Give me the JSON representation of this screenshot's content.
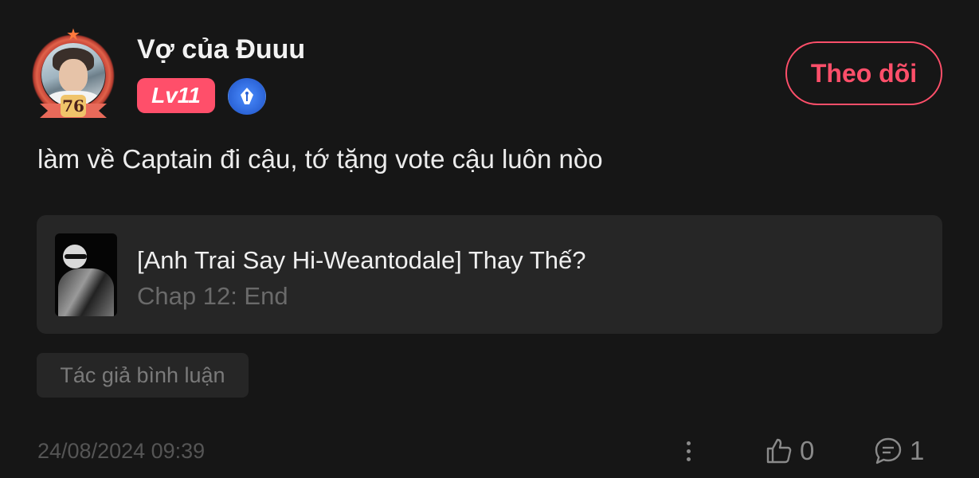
{
  "comment": {
    "author": {
      "name": "Vợ của Đuuu",
      "level": "Lv11",
      "avatar_frame_number": "76",
      "badges": [
        "level-badge",
        "writer-pen-badge"
      ]
    },
    "follow_label": "Theo dõi",
    "text": "làm về Captain đi cậu, tớ tặng vote cậu luôn nòo",
    "linked_story": {
      "title": "[Anh Trai Say Hi-Weantodale] Thay Thế?",
      "chapter": "Chap 12: End"
    },
    "author_tag": "Tác giả bình luận",
    "timestamp": "24/08/2024 09:39",
    "likes": "0",
    "replies": "1"
  },
  "icons": {
    "more": "more-vertical-icon",
    "like": "thumbs-up-icon",
    "reply": "comment-bubble-icon",
    "writer": "pen-nib-icon"
  },
  "colors": {
    "background": "#161616",
    "accent": "#ff4f6a",
    "card": "#262626",
    "muted": "#6a6a6a"
  }
}
